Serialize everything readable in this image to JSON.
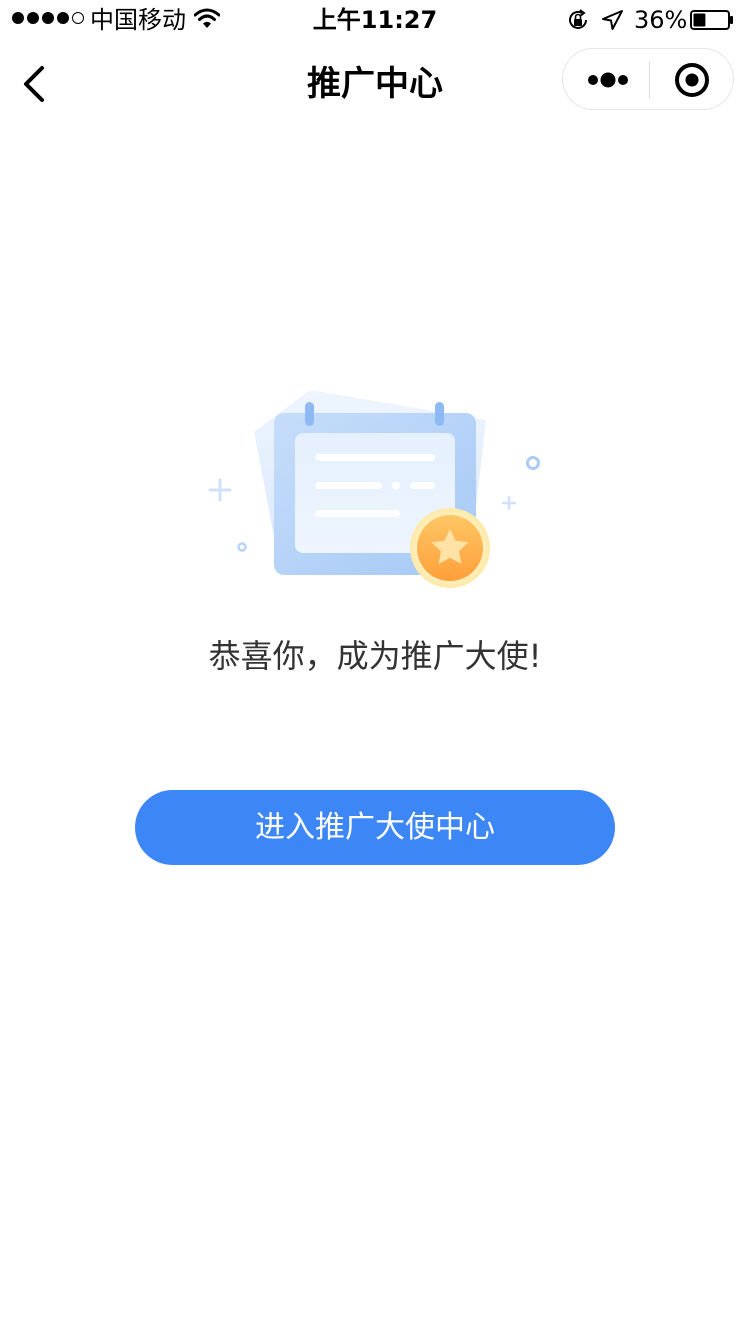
{
  "status_bar": {
    "carrier": "中国移动",
    "time": "上午11:27",
    "battery_percent": "36%",
    "battery_level": 0.36,
    "signal_strength": 4,
    "signal_max": 5
  },
  "nav": {
    "title": "推广中心"
  },
  "content": {
    "illustration": "calendar-card-with-star-badge",
    "message": "恭喜你，成为推广大使!",
    "button_label": "进入推广大使中心"
  },
  "colors": {
    "primary": "#3d86f5",
    "message_text": "#333333",
    "badge": "#ffb347",
    "card": "#a9cdf7"
  }
}
